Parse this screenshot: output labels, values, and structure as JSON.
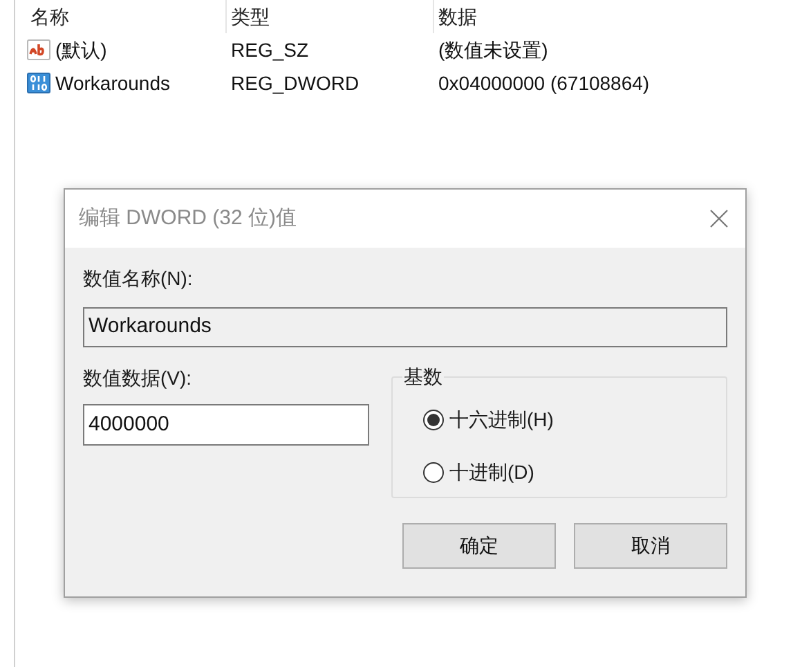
{
  "table": {
    "columns": [
      "名称",
      "类型",
      "数据"
    ],
    "rows": [
      {
        "kind": "string",
        "name": "(默认)",
        "type": "REG_SZ",
        "data": "(数值未设置)"
      },
      {
        "kind": "dword",
        "name": "Workarounds",
        "type": "REG_DWORD",
        "data": "0x04000000 (67108864)"
      }
    ]
  },
  "dialog": {
    "title": "编辑 DWORD (32 位)值",
    "name_label": "数值名称(N):",
    "name_value": "Workarounds",
    "data_label": "数值数据(V):",
    "data_value": "4000000",
    "base": {
      "label": "基数",
      "options": [
        {
          "label": "十六进制(H)",
          "selected": true
        },
        {
          "label": "十进制(D)",
          "selected": false
        }
      ]
    },
    "buttons": [
      "确定",
      "取消"
    ]
  }
}
